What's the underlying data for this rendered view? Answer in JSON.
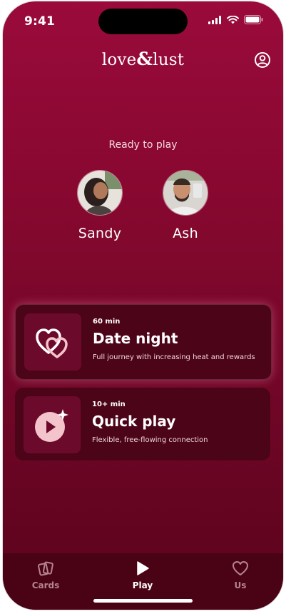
{
  "status_bar": {
    "time": "9:41"
  },
  "header": {
    "logo_left": "love",
    "logo_amp": "&",
    "logo_right": "lust"
  },
  "main": {
    "ready_text": "Ready to play",
    "players": [
      {
        "name": "Sandy"
      },
      {
        "name": "Ash"
      }
    ],
    "cards": [
      {
        "duration": "60 min",
        "title": "Date night",
        "description": "Full journey with increasing heat and rewards",
        "icon": "linked-hearts-icon"
      },
      {
        "duration": "10+ min",
        "title": "Quick play",
        "description": "Flexible, free-flowing connection",
        "icon": "play-sparkle-icon"
      }
    ]
  },
  "tabbar": {
    "items": [
      {
        "label": "Cards",
        "icon": "cards-icon"
      },
      {
        "label": "Play",
        "icon": "play-icon"
      },
      {
        "label": "Us",
        "icon": "heart-icon"
      }
    ],
    "active_color": "#ffffff",
    "inactive_color": "#b5848f"
  },
  "colors": {
    "background_top": "#9a0a3b",
    "background_bottom": "#5a031c",
    "card_bg": "#4c0418",
    "card_icon_bg": "#6c0a2b",
    "accent_pink": "#f4c4cc"
  }
}
